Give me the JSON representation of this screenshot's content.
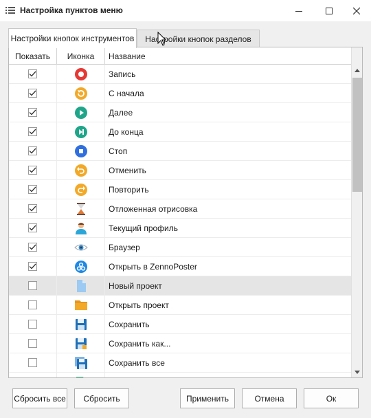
{
  "window": {
    "title": "Настройка пунктов меню",
    "controls": [
      "minimize-icon",
      "maximize-icon",
      "close-icon"
    ]
  },
  "tabs": [
    {
      "label": "Настройки кнопок инструментов",
      "active": true
    },
    {
      "label": "Настройки кнопок разделов",
      "active": false
    }
  ],
  "grid": {
    "columns": [
      "Показать",
      "Иконка",
      "Название"
    ],
    "rows": [
      {
        "name": "Запись",
        "checked": true,
        "icon": "record-icon",
        "color": "#e53935"
      },
      {
        "name": "С начала",
        "checked": true,
        "icon": "restart-icon",
        "color": "#f2a928"
      },
      {
        "name": "Далее",
        "checked": true,
        "icon": "play-icon",
        "color": "#1fa68a"
      },
      {
        "name": "До конца",
        "checked": true,
        "icon": "skip-end-icon",
        "color": "#1fa68a"
      },
      {
        "name": "Стоп",
        "checked": true,
        "icon": "stop-icon",
        "color": "#2f6fe0"
      },
      {
        "name": "Отменить",
        "checked": true,
        "icon": "undo-icon",
        "color": "#f2a928"
      },
      {
        "name": "Повторить",
        "checked": true,
        "icon": "redo-icon",
        "color": "#f2a928"
      },
      {
        "name": "Отложенная отрисовка",
        "checked": true,
        "icon": "hourglass-icon",
        "color": "#e07b39"
      },
      {
        "name": "Текущий профиль",
        "checked": true,
        "icon": "user-profile-icon",
        "color": "#2aa7d8"
      },
      {
        "name": "Браузер",
        "checked": true,
        "icon": "eye-icon",
        "color": "#3a8fd0"
      },
      {
        "name": "Открыть в ZennoPoster",
        "checked": true,
        "icon": "zennoposter-icon",
        "color": "#1e88e5"
      },
      {
        "name": "Новый проект",
        "checked": false,
        "icon": "new-file-icon",
        "color": "#9ccaf2",
        "selected": true
      },
      {
        "name": "Открыть проект",
        "checked": false,
        "icon": "folder-icon",
        "color": "#f2a928"
      },
      {
        "name": "Сохранить",
        "checked": false,
        "icon": "save-icon",
        "color": "#1e6fb8"
      },
      {
        "name": "Сохранить как...",
        "checked": false,
        "icon": "save-as-icon",
        "color": "#1e6fb8"
      },
      {
        "name": "Сохранить все",
        "checked": false,
        "icon": "save-all-icon",
        "color": "#1e6fb8"
      },
      {
        "name": "",
        "checked": false,
        "icon": "export-icon",
        "color": "#2bb07f"
      }
    ]
  },
  "buttons": {
    "reset_all": "Сбросить все",
    "reset": "Сбросить",
    "apply": "Применить",
    "cancel": "Отмена",
    "ok": "Ок"
  }
}
